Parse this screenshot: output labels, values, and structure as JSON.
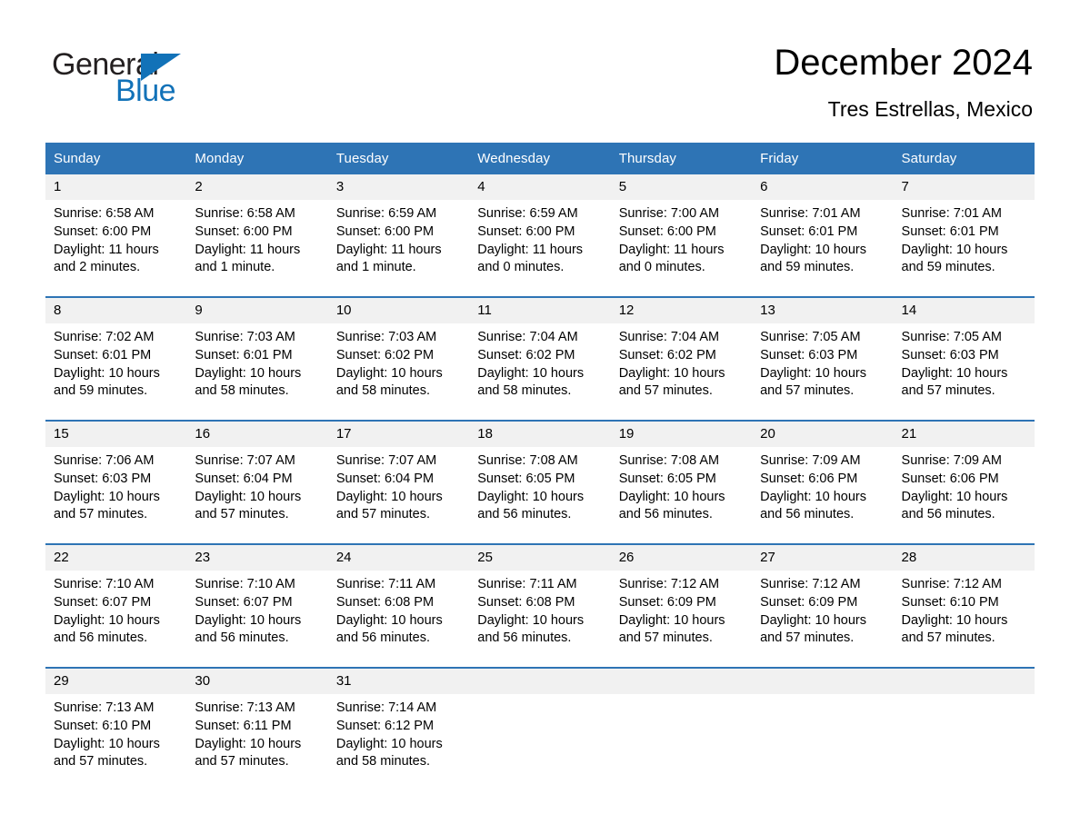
{
  "brand": {
    "name_part1": "General",
    "name_part2": "Blue",
    "triangle_icon": "triangle-icon",
    "accent_color": "#1272b8"
  },
  "header": {
    "month_title": "December 2024",
    "location": "Tres Estrellas, Mexico"
  },
  "theme": {
    "header_blue": "#2e74b5",
    "daynum_bg": "#f1f1f1",
    "page_bg": "#ffffff"
  },
  "calendar": {
    "weekday_headers": [
      "Sunday",
      "Monday",
      "Tuesday",
      "Wednesday",
      "Thursday",
      "Friday",
      "Saturday"
    ],
    "weeks": [
      [
        {
          "day": "1",
          "sunrise": "Sunrise: 6:58 AM",
          "sunset": "Sunset: 6:00 PM",
          "daylight": "Daylight: 11 hours and 2 minutes."
        },
        {
          "day": "2",
          "sunrise": "Sunrise: 6:58 AM",
          "sunset": "Sunset: 6:00 PM",
          "daylight": "Daylight: 11 hours and 1 minute."
        },
        {
          "day": "3",
          "sunrise": "Sunrise: 6:59 AM",
          "sunset": "Sunset: 6:00 PM",
          "daylight": "Daylight: 11 hours and 1 minute."
        },
        {
          "day": "4",
          "sunrise": "Sunrise: 6:59 AM",
          "sunset": "Sunset: 6:00 PM",
          "daylight": "Daylight: 11 hours and 0 minutes."
        },
        {
          "day": "5",
          "sunrise": "Sunrise: 7:00 AM",
          "sunset": "Sunset: 6:00 PM",
          "daylight": "Daylight: 11 hours and 0 minutes."
        },
        {
          "day": "6",
          "sunrise": "Sunrise: 7:01 AM",
          "sunset": "Sunset: 6:01 PM",
          "daylight": "Daylight: 10 hours and 59 minutes."
        },
        {
          "day": "7",
          "sunrise": "Sunrise: 7:01 AM",
          "sunset": "Sunset: 6:01 PM",
          "daylight": "Daylight: 10 hours and 59 minutes."
        }
      ],
      [
        {
          "day": "8",
          "sunrise": "Sunrise: 7:02 AM",
          "sunset": "Sunset: 6:01 PM",
          "daylight": "Daylight: 10 hours and 59 minutes."
        },
        {
          "day": "9",
          "sunrise": "Sunrise: 7:03 AM",
          "sunset": "Sunset: 6:01 PM",
          "daylight": "Daylight: 10 hours and 58 minutes."
        },
        {
          "day": "10",
          "sunrise": "Sunrise: 7:03 AM",
          "sunset": "Sunset: 6:02 PM",
          "daylight": "Daylight: 10 hours and 58 minutes."
        },
        {
          "day": "11",
          "sunrise": "Sunrise: 7:04 AM",
          "sunset": "Sunset: 6:02 PM",
          "daylight": "Daylight: 10 hours and 58 minutes."
        },
        {
          "day": "12",
          "sunrise": "Sunrise: 7:04 AM",
          "sunset": "Sunset: 6:02 PM",
          "daylight": "Daylight: 10 hours and 57 minutes."
        },
        {
          "day": "13",
          "sunrise": "Sunrise: 7:05 AM",
          "sunset": "Sunset: 6:03 PM",
          "daylight": "Daylight: 10 hours and 57 minutes."
        },
        {
          "day": "14",
          "sunrise": "Sunrise: 7:05 AM",
          "sunset": "Sunset: 6:03 PM",
          "daylight": "Daylight: 10 hours and 57 minutes."
        }
      ],
      [
        {
          "day": "15",
          "sunrise": "Sunrise: 7:06 AM",
          "sunset": "Sunset: 6:03 PM",
          "daylight": "Daylight: 10 hours and 57 minutes."
        },
        {
          "day": "16",
          "sunrise": "Sunrise: 7:07 AM",
          "sunset": "Sunset: 6:04 PM",
          "daylight": "Daylight: 10 hours and 57 minutes."
        },
        {
          "day": "17",
          "sunrise": "Sunrise: 7:07 AM",
          "sunset": "Sunset: 6:04 PM",
          "daylight": "Daylight: 10 hours and 57 minutes."
        },
        {
          "day": "18",
          "sunrise": "Sunrise: 7:08 AM",
          "sunset": "Sunset: 6:05 PM",
          "daylight": "Daylight: 10 hours and 56 minutes."
        },
        {
          "day": "19",
          "sunrise": "Sunrise: 7:08 AM",
          "sunset": "Sunset: 6:05 PM",
          "daylight": "Daylight: 10 hours and 56 minutes."
        },
        {
          "day": "20",
          "sunrise": "Sunrise: 7:09 AM",
          "sunset": "Sunset: 6:06 PM",
          "daylight": "Daylight: 10 hours and 56 minutes."
        },
        {
          "day": "21",
          "sunrise": "Sunrise: 7:09 AM",
          "sunset": "Sunset: 6:06 PM",
          "daylight": "Daylight: 10 hours and 56 minutes."
        }
      ],
      [
        {
          "day": "22",
          "sunrise": "Sunrise: 7:10 AM",
          "sunset": "Sunset: 6:07 PM",
          "daylight": "Daylight: 10 hours and 56 minutes."
        },
        {
          "day": "23",
          "sunrise": "Sunrise: 7:10 AM",
          "sunset": "Sunset: 6:07 PM",
          "daylight": "Daylight: 10 hours and 56 minutes."
        },
        {
          "day": "24",
          "sunrise": "Sunrise: 7:11 AM",
          "sunset": "Sunset: 6:08 PM",
          "daylight": "Daylight: 10 hours and 56 minutes."
        },
        {
          "day": "25",
          "sunrise": "Sunrise: 7:11 AM",
          "sunset": "Sunset: 6:08 PM",
          "daylight": "Daylight: 10 hours and 56 minutes."
        },
        {
          "day": "26",
          "sunrise": "Sunrise: 7:12 AM",
          "sunset": "Sunset: 6:09 PM",
          "daylight": "Daylight: 10 hours and 57 minutes."
        },
        {
          "day": "27",
          "sunrise": "Sunrise: 7:12 AM",
          "sunset": "Sunset: 6:09 PM",
          "daylight": "Daylight: 10 hours and 57 minutes."
        },
        {
          "day": "28",
          "sunrise": "Sunrise: 7:12 AM",
          "sunset": "Sunset: 6:10 PM",
          "daylight": "Daylight: 10 hours and 57 minutes."
        }
      ],
      [
        {
          "day": "29",
          "sunrise": "Sunrise: 7:13 AM",
          "sunset": "Sunset: 6:10 PM",
          "daylight": "Daylight: 10 hours and 57 minutes."
        },
        {
          "day": "30",
          "sunrise": "Sunrise: 7:13 AM",
          "sunset": "Sunset: 6:11 PM",
          "daylight": "Daylight: 10 hours and 57 minutes."
        },
        {
          "day": "31",
          "sunrise": "Sunrise: 7:14 AM",
          "sunset": "Sunset: 6:12 PM",
          "daylight": "Daylight: 10 hours and 58 minutes."
        },
        {
          "day": "",
          "sunrise": "",
          "sunset": "",
          "daylight": ""
        },
        {
          "day": "",
          "sunrise": "",
          "sunset": "",
          "daylight": ""
        },
        {
          "day": "",
          "sunrise": "",
          "sunset": "",
          "daylight": ""
        },
        {
          "day": "",
          "sunrise": "",
          "sunset": "",
          "daylight": ""
        }
      ]
    ]
  }
}
